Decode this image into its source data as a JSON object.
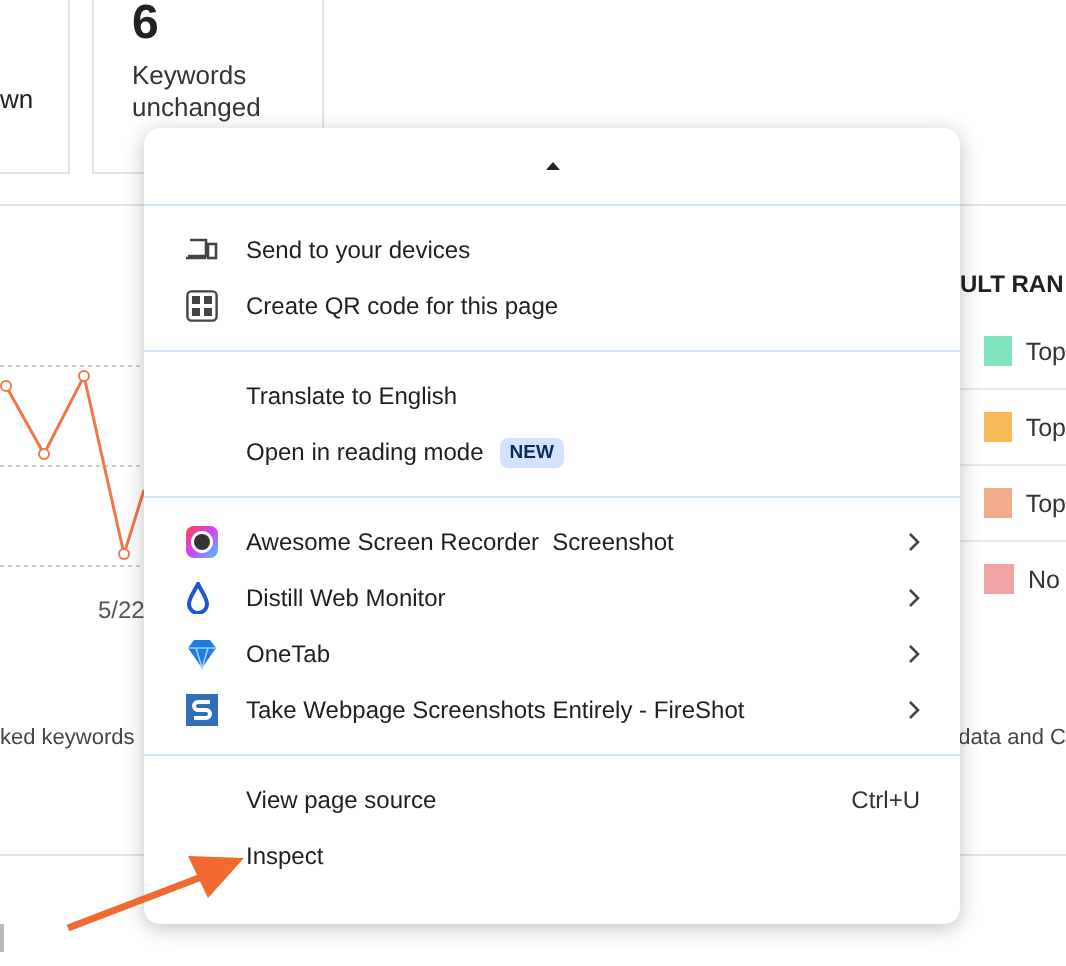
{
  "stat_cards": [
    {
      "label": "wn"
    },
    {
      "value": "6",
      "label": "Keywords unchanged"
    }
  ],
  "chart": {
    "x_label": "5/22"
  },
  "legend": {
    "title": "ULT RAN",
    "items": [
      {
        "label": "Top",
        "color": "#7fe3bd"
      },
      {
        "label": "Top",
        "color": "#f5ba57"
      },
      {
        "label": "Top",
        "color": "#f0ab8a"
      },
      {
        "label": "No",
        "color": "#f0a3a3"
      }
    ]
  },
  "footnotes": [
    "ked keywords",
    "data and C"
  ],
  "context_menu": {
    "sections": [
      [
        {
          "kind": "scroll_up"
        }
      ],
      [
        {
          "kind": "item",
          "label": "Send to your devices",
          "submenu": false
        },
        {
          "kind": "item",
          "label": "Create QR code for this page",
          "submenu": false
        }
      ],
      [
        {
          "kind": "item",
          "label": "Translate to English",
          "submenu": false
        },
        {
          "kind": "item",
          "label": "Open in reading mode",
          "badge": "NEW",
          "submenu": false
        }
      ],
      [
        {
          "kind": "item",
          "label": "Awesome Screen Recorder  Screenshot",
          "submenu": true
        },
        {
          "kind": "item",
          "label": "Distill Web Monitor",
          "submenu": true
        },
        {
          "kind": "item",
          "label": "OneTab",
          "submenu": true
        },
        {
          "kind": "item",
          "label": "Take Webpage Screenshots Entirely - FireShot",
          "submenu": true
        }
      ],
      [
        {
          "kind": "item",
          "label": "View page source",
          "shortcut": "Ctrl+U",
          "submenu": false
        },
        {
          "kind": "item",
          "label": "Inspect",
          "submenu": false
        }
      ]
    ]
  }
}
